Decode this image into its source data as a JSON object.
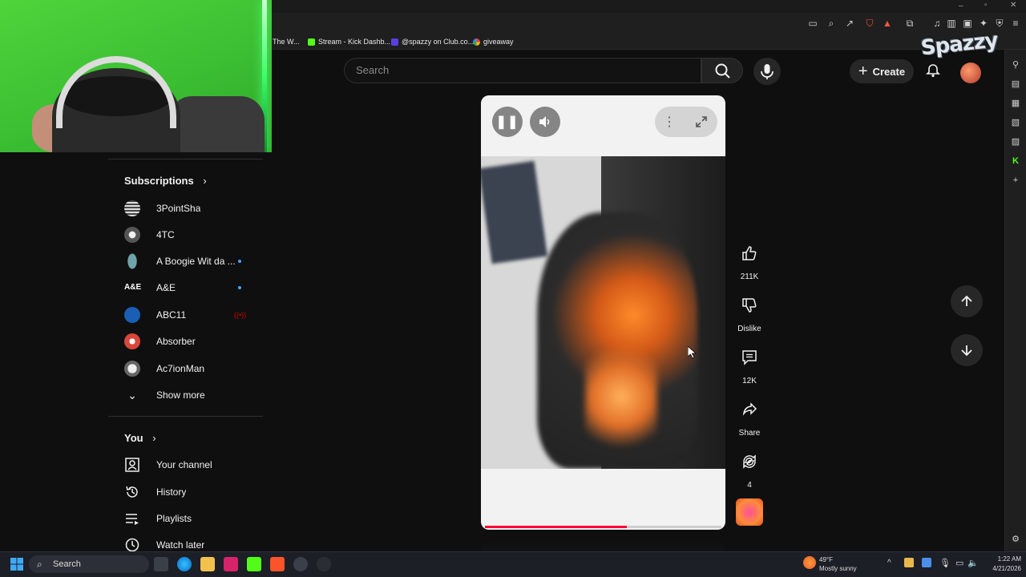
{
  "bookmarks": [
    {
      "label": "The W...",
      "color": "#555555"
    },
    {
      "label": "Stream - Kick Dashb...",
      "color": "#53fc18"
    },
    {
      "label": "@spazzy on Club.co...",
      "color": "#5a3ee6"
    },
    {
      "label": "giveaway",
      "color": "#ea4335"
    }
  ],
  "streamer_logo": "Spazzy",
  "header": {
    "search_placeholder": "Search",
    "create_label": "Create"
  },
  "sidebar": {
    "subscriptions_title": "Subscriptions",
    "channels": [
      {
        "name": "3PointSha",
        "color": "#bbbbbb",
        "indicator": "none"
      },
      {
        "name": "4TC",
        "color": "#9a9a9a",
        "indicator": "none"
      },
      {
        "name": "A Boogie Wit da ...",
        "color": "#6fa3a8",
        "indicator": "new"
      },
      {
        "name": "A&E",
        "color": "#ffffff",
        "indicator": "new"
      },
      {
        "name": "ABC11",
        "color": "#1a5fb4",
        "indicator": "live"
      },
      {
        "name": "Absorber",
        "color": "#d9463b",
        "indicator": "none"
      },
      {
        "name": "Ac7ionMan",
        "color": "#cccccc",
        "indicator": "none"
      }
    ],
    "show_more": "Show more",
    "you_title": "You",
    "you_items": [
      {
        "label": "Your channel",
        "icon": "your-channel-icon"
      },
      {
        "label": "History",
        "icon": "history-icon"
      },
      {
        "label": "Playlists",
        "icon": "playlists-icon"
      },
      {
        "label": "Watch later",
        "icon": "watch-later-icon"
      }
    ]
  },
  "player": {
    "progress_fraction": 0.6,
    "progress_color": "#ff0033"
  },
  "actions": {
    "like_count": "211K",
    "dislike_label": "Dislike",
    "comment_count": "12K",
    "share_label": "Share",
    "remix_count": "4"
  },
  "taskbar": {
    "search_label": "Search",
    "weather_temp": "49°F",
    "weather_desc": "Mostly sunny",
    "time": "1:22 AM",
    "date": "4/21/2026"
  }
}
